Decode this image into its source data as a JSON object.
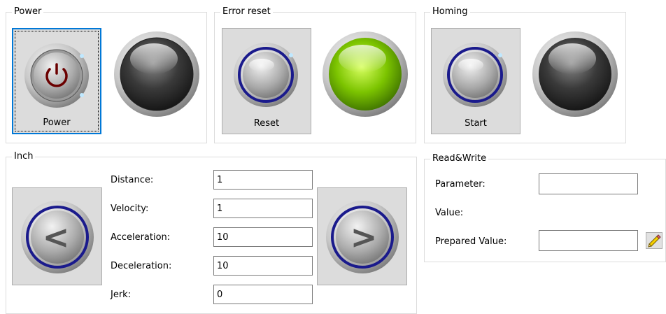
{
  "power": {
    "title": "Power",
    "button_label": "Power",
    "button_icon": "power-icon",
    "lamp_state": "off",
    "lamp_color": "#2b2b2b"
  },
  "error_reset": {
    "title": "Error reset",
    "button_label": "Reset",
    "lamp_state": "on",
    "lamp_color": "#7cc400"
  },
  "homing": {
    "title": "Homing",
    "button_label": "Start",
    "lamp_state": "off",
    "lamp_color": "#2b2b2b"
  },
  "inch": {
    "title": "Inch",
    "left_button_icon": "arrow-left-icon",
    "right_button_icon": "arrow-right-icon",
    "left_glyph": "<",
    "right_glyph": ">",
    "fields": [
      {
        "label": "Distance:",
        "value": "1"
      },
      {
        "label": "Velocity:",
        "value": "1"
      },
      {
        "label": "Acceleration:",
        "value": "10"
      },
      {
        "label": "Deceleration:",
        "value": "10"
      },
      {
        "label": "Jerk:",
        "value": "0"
      }
    ]
  },
  "read_write": {
    "title": "Read&Write",
    "parameter_label": "Parameter:",
    "parameter_value": "",
    "value_label": "Value:",
    "value_text": "",
    "prepared_value_label": "Prepared Value:",
    "prepared_value": "",
    "write_icon": "pencil-icon"
  },
  "colors": {
    "focus_border": "#0078d7",
    "button_face": "#dcdcdc",
    "ring_blue": "#1a1a8c",
    "power_symbol": "#6b0000"
  }
}
